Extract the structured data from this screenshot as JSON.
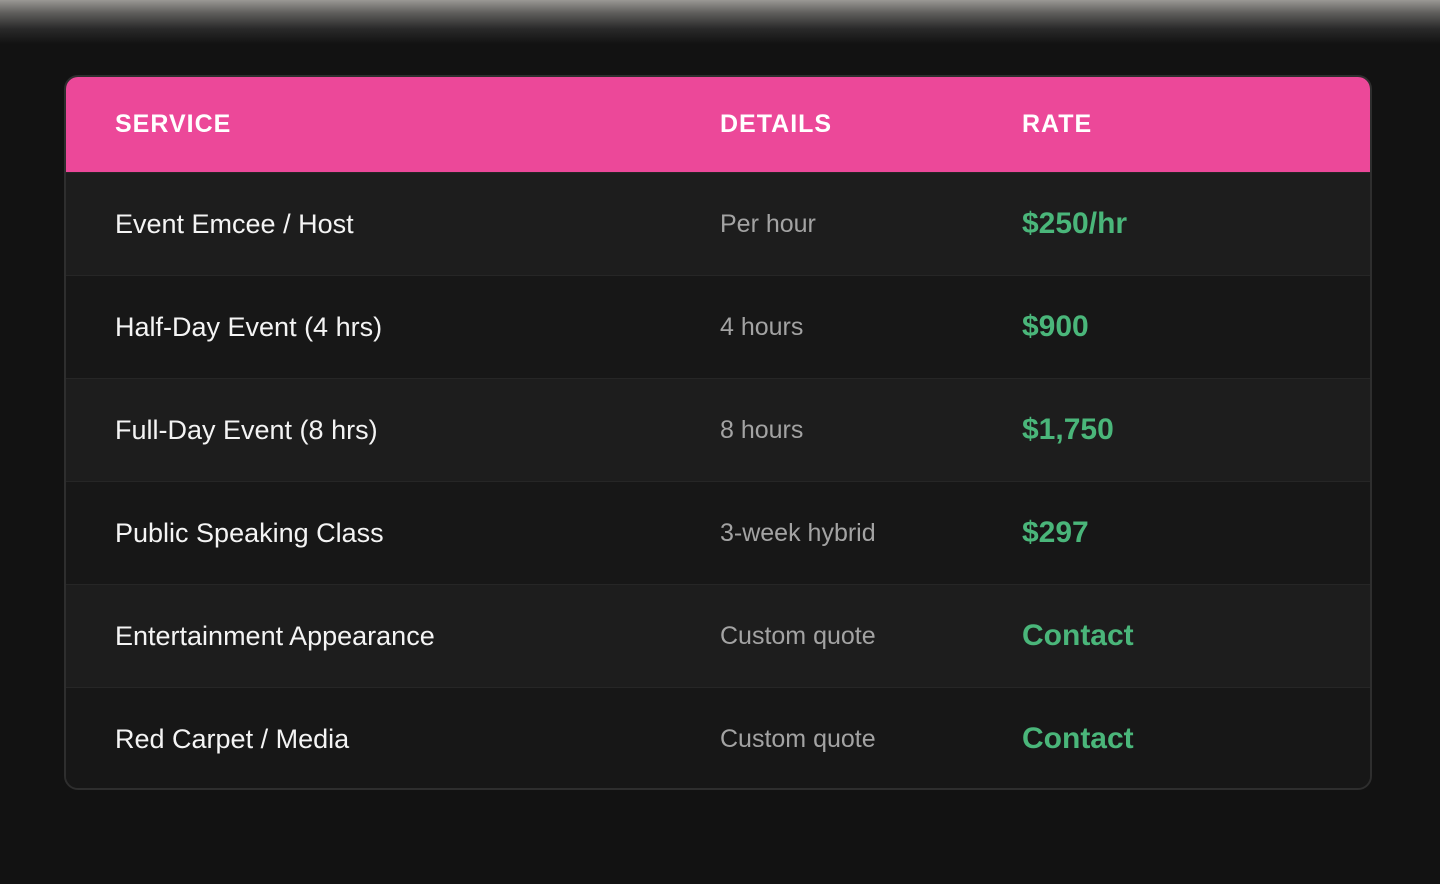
{
  "table": {
    "headers": {
      "service": "SERVICE",
      "details": "DETAILS",
      "rate": "RATE"
    },
    "rows": [
      {
        "service": "Event Emcee / Host",
        "details": "Per hour",
        "rate": "$250/hr"
      },
      {
        "service": "Half-Day Event (4 hrs)",
        "details": "4 hours",
        "rate": "$900"
      },
      {
        "service": "Full-Day Event (8 hrs)",
        "details": "8 hours",
        "rate": "$1,750"
      },
      {
        "service": "Public Speaking Class",
        "details": "3-week hybrid",
        "rate": "$297"
      },
      {
        "service": "Entertainment Appearance",
        "details": "Custom quote",
        "rate": "Contact"
      },
      {
        "service": "Red Carpet / Media",
        "details": "Custom quote",
        "rate": "Contact"
      }
    ]
  },
  "colors": {
    "header_bg": "#ec4899",
    "rate_text": "#4ab67a",
    "page_bg": "#121212"
  }
}
